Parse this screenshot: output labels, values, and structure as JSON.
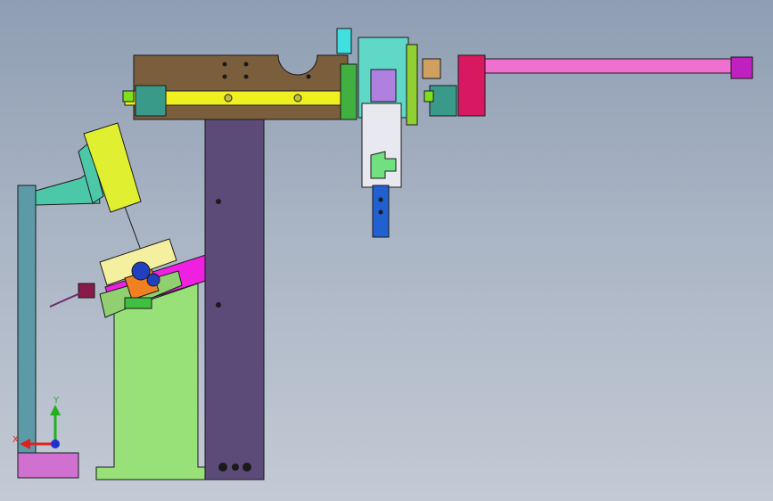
{
  "triad": {
    "x_label": "X",
    "y_label": "Y",
    "colors": {
      "x": "#e02020",
      "y": "#20b020",
      "z": "#2030d0"
    }
  },
  "colors": {
    "background_top": "#8f9eb3",
    "background_bottom": "#c3cad5",
    "beam": "#7b5f3c",
    "rail": "#f0f020",
    "column": "#5c4a78",
    "support": "#98e078",
    "side_post": "#5c9aa8",
    "foot": "#d070d0",
    "cylinder": "#f070d0",
    "cylinder_end": "#d81860",
    "carriage": "#b080e0",
    "gripper": "#e8e8f0",
    "blue_bar": "#2060d0",
    "tilt_plate": "#f020e0",
    "green_part": "#40c040",
    "yellow_green": "#e0f030",
    "orange": "#f08020"
  }
}
